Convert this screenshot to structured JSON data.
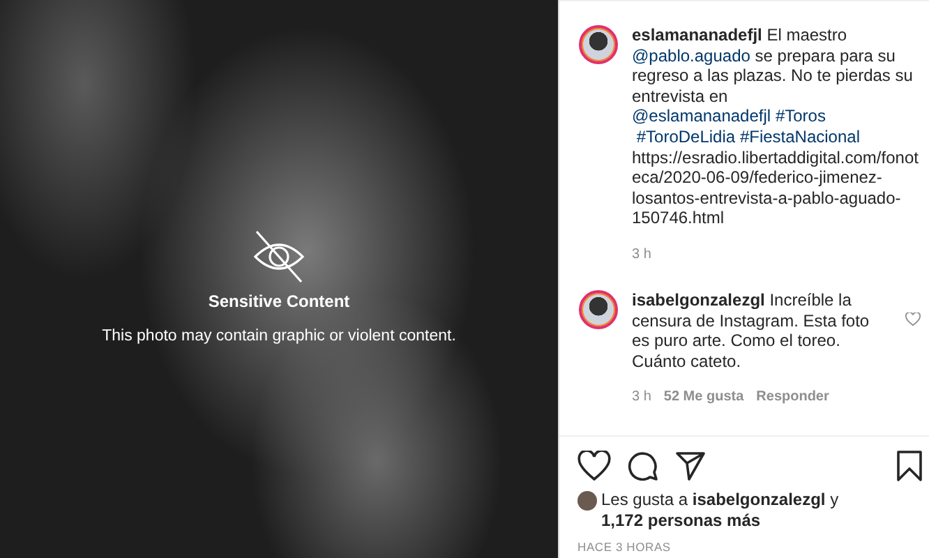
{
  "media": {
    "title": "Sensitive Content",
    "message": "This photo may contain graphic or violent content."
  },
  "caption": {
    "time": "3 h",
    "segments": [
      {
        "kind": "user",
        "text": "eslamananadefjl"
      },
      {
        "kind": "text",
        "text": " El maestro "
      },
      {
        "kind": "link",
        "text": "@pablo.aguado"
      },
      {
        "kind": "text",
        "text": " se prepara para su regreso a las plazas. No te pierdas su entrevista en "
      },
      {
        "kind": "link",
        "text": "@eslamananadefjl"
      },
      {
        "kind": "link",
        "text": "#Toros"
      },
      {
        "kind": "link",
        "text": "#ToroDeLidia"
      },
      {
        "kind": "link",
        "text": "#FiestaNacional"
      },
      {
        "kind": "text",
        "text": " https://esradio.libertaddigital.com/fonoteca/2020-06-09/federico-jimenez-losantos-entrevista-a-pablo-aguado-150746.html"
      }
    ]
  },
  "comments": [
    {
      "user": "isabelgonzalezgl",
      "text": "Increíble la censura de Instagram. Esta foto es puro arte. Como el toreo. Cuánto cateto.",
      "time": "3 h",
      "likes": "52 Me gusta",
      "reply": "Responder",
      "liked": false
    }
  ],
  "actions": {
    "liked": false,
    "saved": false
  },
  "likes": {
    "prefix": "Les gusta a ",
    "user": "isabelgonzalezgl",
    "middle": " y ",
    "others": "1,172 personas más"
  },
  "posted": "HACE 3 HORAS"
}
